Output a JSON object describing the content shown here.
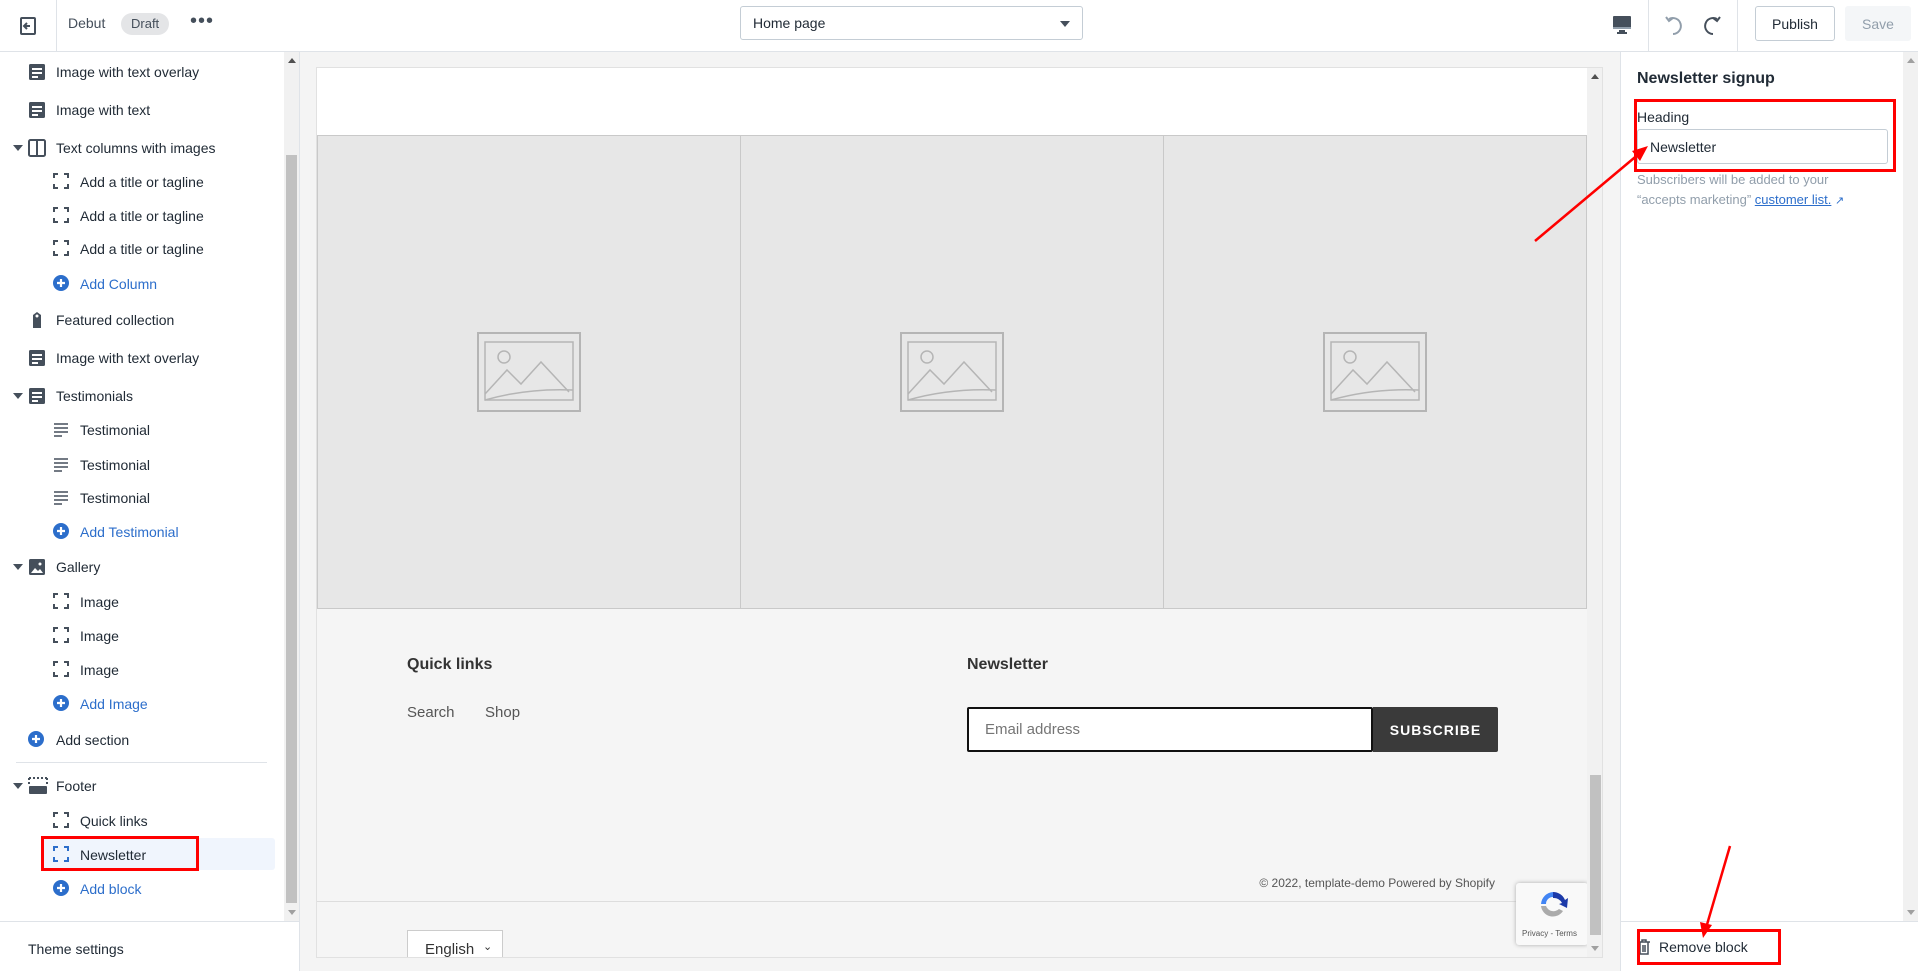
{
  "header": {
    "theme_name": "Debut",
    "status_badge": "Draft",
    "page_select": "Home page",
    "publish_label": "Publish",
    "save_label": "Save"
  },
  "sidebar": {
    "items": [
      {
        "label": "Image with text overlay"
      },
      {
        "label": "Image with text"
      },
      {
        "label": "Text columns with images"
      },
      {
        "label": "Add a title or tagline"
      },
      {
        "label": "Add a title or tagline"
      },
      {
        "label": "Add a title or tagline"
      },
      {
        "label": "Add Column"
      },
      {
        "label": "Featured collection"
      },
      {
        "label": "Image with text overlay"
      },
      {
        "label": "Testimonials"
      },
      {
        "label": "Testimonial"
      },
      {
        "label": "Testimonial"
      },
      {
        "label": "Testimonial"
      },
      {
        "label": "Add Testimonial"
      },
      {
        "label": "Gallery"
      },
      {
        "label": "Image"
      },
      {
        "label": "Image"
      },
      {
        "label": "Image"
      },
      {
        "label": "Add Image"
      },
      {
        "label": "Add section"
      },
      {
        "label": "Footer"
      },
      {
        "label": "Quick links"
      },
      {
        "label": "Newsletter"
      },
      {
        "label": "Add block"
      }
    ],
    "theme_settings": "Theme settings"
  },
  "preview": {
    "quick_links_heading": "Quick links",
    "links": [
      "Search",
      "Shop"
    ],
    "newsletter_heading": "Newsletter",
    "email_placeholder": "Email address",
    "subscribe_label": "SUBSCRIBE",
    "language": "English",
    "copyright": "© 2022, template-demo Powered by Shopify",
    "recaptcha_text": "Privacy - Terms"
  },
  "settings": {
    "title": "Newsletter signup",
    "heading_label": "Heading",
    "heading_value": "Newsletter",
    "help_text": "Subscribers will be added to your “accepts marketing”",
    "help_link": "customer list.",
    "remove_label": "Remove block"
  },
  "colors": {
    "accent": "#2c6ecb",
    "annotation": "#ff0000",
    "subscribe_bg": "#3a3a3a"
  }
}
